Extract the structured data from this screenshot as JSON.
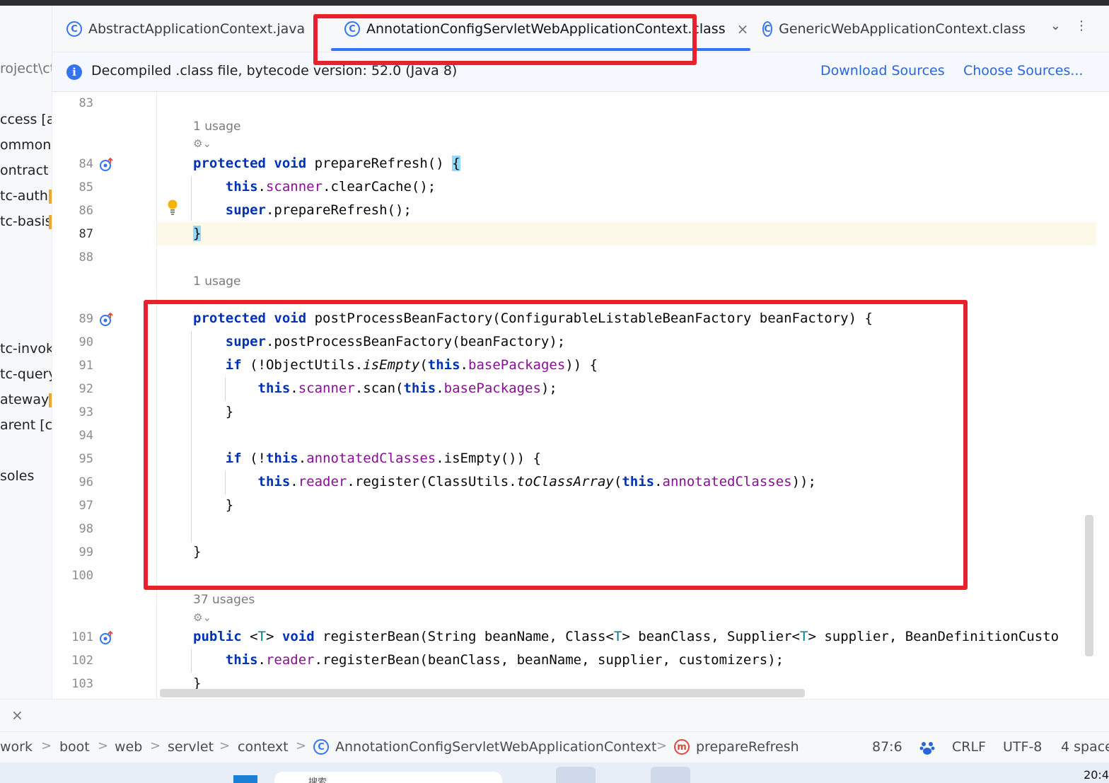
{
  "left_panel": {
    "items": [
      {
        "text": "roject\\ct"
      },
      {
        "text": "ccess [a"
      },
      {
        "text": "ommon"
      },
      {
        "text": "ontract ["
      },
      {
        "text": "tc-auth"
      },
      {
        "text": "tc-basis"
      },
      {
        "text": "tc-invok"
      },
      {
        "text": "tc-query"
      },
      {
        "text": "ateway"
      },
      {
        "text": "arent [ct"
      },
      {
        "text": "soles"
      }
    ]
  },
  "tabs": [
    {
      "label": "AbstractApplicationContext.java",
      "active": false
    },
    {
      "label": "AnnotationConfigServletWebApplicationContext.class",
      "active": true
    },
    {
      "label": "GenericWebApplicationContext.class",
      "active": false
    }
  ],
  "tab_icon_letter": "C",
  "tab_close_glyph": "×",
  "tab_more_glyph": "⌄",
  "tab_menu_glyph": "⋮",
  "banner": {
    "icon_glyph": "i",
    "text": "Decompiled .class file, bytecode version: 52.0 (Java 8)",
    "download_sources": "Download Sources",
    "choose_sources": "Choose Sources..."
  },
  "editor": {
    "line_numbers": [
      "83",
      "84",
      "85",
      "86",
      "87",
      "88",
      "89",
      "90",
      "91",
      "92",
      "93",
      "94",
      "95",
      "96",
      "97",
      "98",
      "99",
      "100",
      "101",
      "102",
      "103"
    ],
    "current_line": "87",
    "usages": [
      "1 usage",
      "1 usage",
      "37 usages"
    ],
    "ai_glyph": "⚙⌄"
  },
  "breadcrumb": {
    "items": [
      "work",
      "boot",
      "web",
      "servlet",
      "context",
      "AnnotationConfigServletWebApplicationContext",
      "prepareRefresh"
    ],
    "separator": ">",
    "class_icon_letter": "C",
    "method_icon_letter": "m"
  },
  "status": {
    "position": "87:6",
    "line_sep": "CRLF",
    "encoding": "UTF-8",
    "indent": "4 space"
  },
  "bottom_close": "×",
  "taskbar": {
    "clock": "20:4",
    "search_text": "搜索"
  },
  "colors": {
    "accent": "#3574f0",
    "annotation_red": "#e8222c",
    "keyword": "#0033b3",
    "field": "#871094"
  }
}
